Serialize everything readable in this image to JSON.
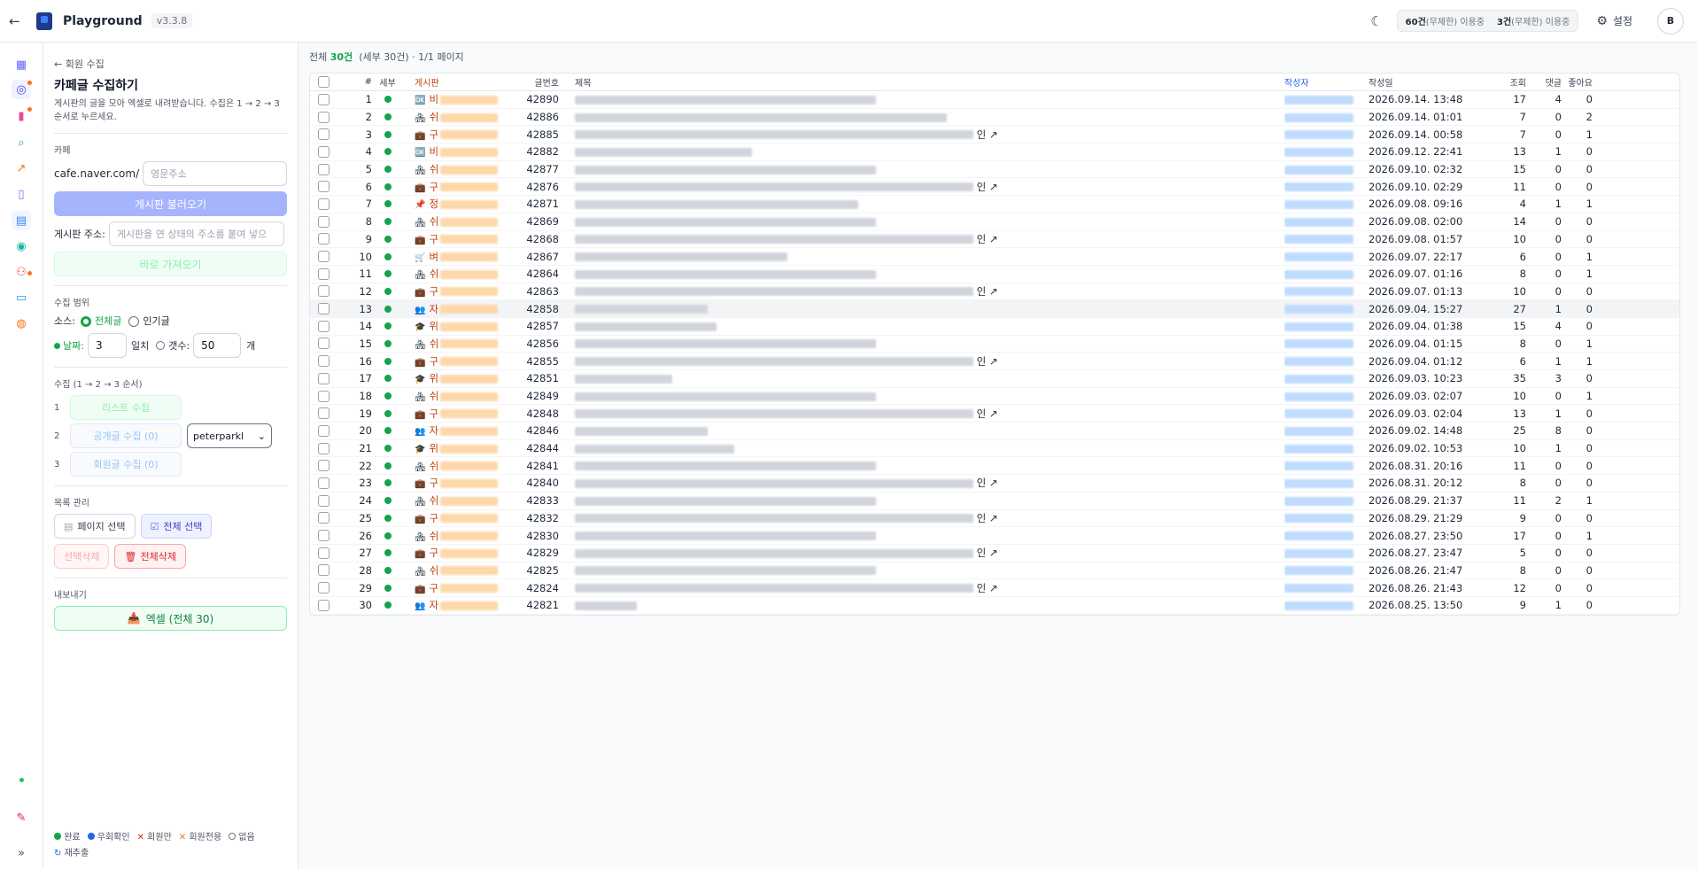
{
  "app": {
    "name": "Playground",
    "version": "v3.3.8"
  },
  "usage": {
    "a_count": "60건",
    "a_note": "(무제한) 이용중",
    "b_count": "3건",
    "b_note": "(무제한) 이용중"
  },
  "header": {
    "settings_label": "설정",
    "avatar_initial": "B"
  },
  "sidebar": {
    "breadcrumb": "← 회원 수집",
    "title": "카페글 수집하기",
    "description": "게시판의 글을 모아 엑셀로 내려받습니다. 수집은 1 → 2 → 3 순서로 누르세요.",
    "cafe_label": "카페",
    "cafe_prefix": "cafe.naver.com/",
    "cafe_placeholder": "영문주소",
    "load_boards_button": "게시판 불러오기",
    "board_addr_label": "게시판 주소:",
    "board_addr_placeholder": "게시판을 연 상태의 주소를 붙여 넣으",
    "direct_fetch_button": "바로 가져오기",
    "range_label": "수집 범위",
    "source_label": "소스:",
    "source_all": "전체글",
    "source_popular": "인기글",
    "date_label": "날짜:",
    "date_value": "3",
    "date_unit": "일치",
    "count_label": "갯수:",
    "count_value": "50",
    "count_unit": "개",
    "collect_label": "수집 (1 → 2 → 3 순서)",
    "step1_num": "1",
    "step1": "리스트 수집",
    "step2_num": "2",
    "step2": "공개글 수집 (0)",
    "step3_num": "3",
    "step3": "회원글 수집 (0)",
    "account_select": "peterparkl",
    "list_mgmt_label": "목록 관리",
    "page_select": "페이지 선택",
    "all_select": "전체 선택",
    "sel_delete": "선택삭제",
    "all_delete": "전체삭제",
    "export_label": "내보내기",
    "excel_button": "엑셀 (전체 30)",
    "legend": {
      "done": "완료",
      "bypass": "우회확인",
      "member_only": "회원만",
      "member_exclusive": "회원전용",
      "none": "없음",
      "retry": "재추출"
    }
  },
  "summary": {
    "prefix": "전체",
    "count": "30건",
    "detail": "(세부 30건)",
    "pages": "· 1/1 페이지"
  },
  "table": {
    "headers": {
      "no": "#",
      "detail": "세부",
      "board": "게시판",
      "post_no": "글번호",
      "title": "제목",
      "author": "작성자",
      "date": "작성일",
      "views": "조회",
      "comments": "댓글",
      "likes": "좋아요"
    },
    "rows": [
      {
        "n": "1",
        "icon": "🆗",
        "cat": "비",
        "post": "42890",
        "title_tail": "",
        "date": "2026.09.14. 13:48",
        "v": "17",
        "c": "4",
        "l": "0"
      },
      {
        "n": "2",
        "icon": "🏘",
        "cat": "쉬",
        "post": "42886",
        "title_tail": "",
        "date": "2026.09.14. 01:01",
        "v": "7",
        "c": "0",
        "l": "2"
      },
      {
        "n": "3",
        "icon": "💼",
        "cat": "구",
        "post": "42885",
        "title_tail": "인 ↗",
        "date": "2026.09.14. 00:58",
        "v": "7",
        "c": "0",
        "l": "1"
      },
      {
        "n": "4",
        "icon": "🆗",
        "cat": "비",
        "post": "42882",
        "title_tail": "",
        "date": "2026.09.12. 22:41",
        "v": "13",
        "c": "1",
        "l": "0"
      },
      {
        "n": "5",
        "icon": "🏘",
        "cat": "쉬",
        "post": "42877",
        "title_tail": "",
        "date": "2026.09.10. 02:32",
        "v": "15",
        "c": "0",
        "l": "0"
      },
      {
        "n": "6",
        "icon": "💼",
        "cat": "구",
        "post": "42876",
        "title_tail": "인 ↗",
        "date": "2026.09.10. 02:29",
        "v": "11",
        "c": "0",
        "l": "0"
      },
      {
        "n": "7",
        "icon": "📌",
        "cat": "정",
        "post": "42871",
        "title_tail": "",
        "date": "2026.09.08. 09:16",
        "v": "4",
        "c": "1",
        "l": "1"
      },
      {
        "n": "8",
        "icon": "🏘",
        "cat": "쉬",
        "post": "42869",
        "title_tail": "",
        "date": "2026.09.08. 02:00",
        "v": "14",
        "c": "0",
        "l": "0"
      },
      {
        "n": "9",
        "icon": "💼",
        "cat": "구",
        "post": "42868",
        "title_tail": "인 ↗",
        "date": "2026.09.08. 01:57",
        "v": "10",
        "c": "0",
        "l": "0"
      },
      {
        "n": "10",
        "icon": "🛒",
        "cat": "벼",
        "post": "42867",
        "title_tail": "",
        "date": "2026.09.07. 22:17",
        "v": "6",
        "c": "0",
        "l": "1"
      },
      {
        "n": "11",
        "icon": "🏘",
        "cat": "쉬",
        "post": "42864",
        "title_tail": "",
        "date": "2026.09.07. 01:16",
        "v": "8",
        "c": "0",
        "l": "1"
      },
      {
        "n": "12",
        "icon": "💼",
        "cat": "구",
        "post": "42863",
        "title_tail": "인 ↗",
        "date": "2026.09.07. 01:13",
        "v": "10",
        "c": "0",
        "l": "0"
      },
      {
        "n": "13",
        "icon": "👥",
        "cat": "자",
        "post": "42858",
        "title_tail": "",
        "date": "2026.09.04. 15:27",
        "v": "27",
        "c": "1",
        "l": "0"
      },
      {
        "n": "14",
        "icon": "🎓",
        "cat": "위",
        "post": "42857",
        "title_tail": "",
        "date": "2026.09.04. 01:38",
        "v": "15",
        "c": "4",
        "l": "0"
      },
      {
        "n": "15",
        "icon": "🏘",
        "cat": "쉬",
        "post": "42856",
        "title_tail": "",
        "date": "2026.09.04. 01:15",
        "v": "8",
        "c": "0",
        "l": "1"
      },
      {
        "n": "16",
        "icon": "💼",
        "cat": "구",
        "post": "42855",
        "title_tail": "인 ↗",
        "date": "2026.09.04. 01:12",
        "v": "6",
        "c": "1",
        "l": "1"
      },
      {
        "n": "17",
        "icon": "🎓",
        "cat": "위",
        "post": "42851",
        "title_tail": "",
        "date": "2026.09.03. 10:23",
        "v": "35",
        "c": "3",
        "l": "0"
      },
      {
        "n": "18",
        "icon": "🏘",
        "cat": "쉬",
        "post": "42849",
        "title_tail": "",
        "date": "2026.09.03. 02:07",
        "v": "10",
        "c": "0",
        "l": "1"
      },
      {
        "n": "19",
        "icon": "💼",
        "cat": "구",
        "post": "42848",
        "title_tail": "인 ↗",
        "date": "2026.09.03. 02:04",
        "v": "13",
        "c": "1",
        "l": "0"
      },
      {
        "n": "20",
        "icon": "👥",
        "cat": "자",
        "post": "42846",
        "title_tail": "",
        "date": "2026.09.02. 14:48",
        "v": "25",
        "c": "8",
        "l": "0"
      },
      {
        "n": "21",
        "icon": "🎓",
        "cat": "위",
        "post": "42844",
        "title_tail": "",
        "date": "2026.09.02. 10:53",
        "v": "10",
        "c": "1",
        "l": "0"
      },
      {
        "n": "22",
        "icon": "🏘",
        "cat": "쉬",
        "post": "42841",
        "title_tail": "",
        "date": "2026.08.31. 20:16",
        "v": "11",
        "c": "0",
        "l": "0"
      },
      {
        "n": "23",
        "icon": "💼",
        "cat": "구",
        "post": "42840",
        "title_tail": "인 ↗",
        "date": "2026.08.31. 20:12",
        "v": "8",
        "c": "0",
        "l": "0"
      },
      {
        "n": "24",
        "icon": "🏘",
        "cat": "쉬",
        "post": "42833",
        "title_tail": "",
        "date": "2026.08.29. 21:37",
        "v": "11",
        "c": "2",
        "l": "1"
      },
      {
        "n": "25",
        "icon": "💼",
        "cat": "구",
        "post": "42832",
        "title_tail": "인 ↗",
        "date": "2026.08.29. 21:29",
        "v": "9",
        "c": "0",
        "l": "0"
      },
      {
        "n": "26",
        "icon": "🏘",
        "cat": "쉬",
        "post": "42830",
        "title_tail": "",
        "date": "2026.08.27. 23:50",
        "v": "17",
        "c": "0",
        "l": "1"
      },
      {
        "n": "27",
        "icon": "💼",
        "cat": "구",
        "post": "42829",
        "title_tail": "인 ↗",
        "date": "2026.08.27. 23:47",
        "v": "5",
        "c": "0",
        "l": "0"
      },
      {
        "n": "28",
        "icon": "🏘",
        "cat": "쉬",
        "post": "42825",
        "title_tail": "",
        "date": "2026.08.26. 21:47",
        "v": "8",
        "c": "0",
        "l": "0"
      },
      {
        "n": "29",
        "icon": "💼",
        "cat": "구",
        "post": "42824",
        "title_tail": "인 ↗",
        "date": "2026.08.26. 21:43",
        "v": "12",
        "c": "0",
        "l": "0"
      },
      {
        "n": "30",
        "icon": "👥",
        "cat": "자",
        "post": "42821",
        "title_tail": "",
        "date": "2026.08.25. 13:50",
        "v": "9",
        "c": "1",
        "l": "0"
      }
    ]
  },
  "colors": {
    "accent_green": "#16a34a",
    "link_blue": "#2563eb",
    "category_orange": "#c2410c"
  }
}
